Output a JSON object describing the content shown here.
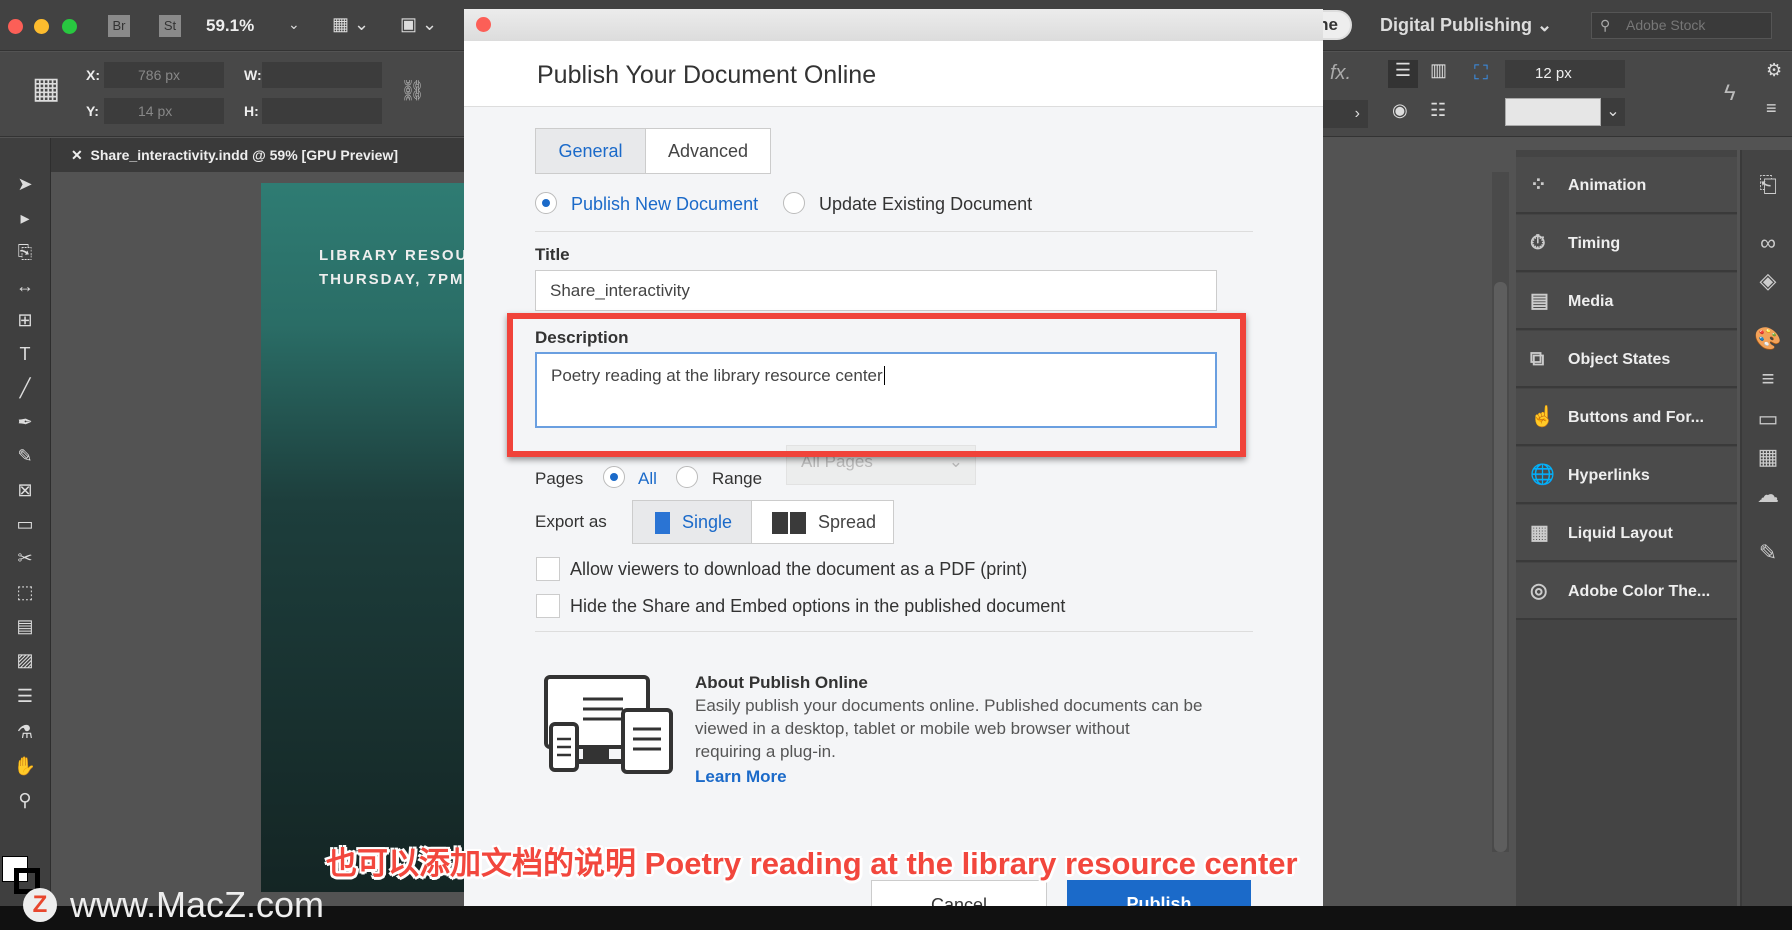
{
  "app": {
    "bridge": "Br",
    "stock": "St",
    "zoom": "59.1%",
    "workspace": "Digital Publishing",
    "search_placeholder": "Adobe Stock",
    "tab_title": "Share_interactivity.indd @ 59% [GPU Preview]",
    "partial_button": "ne"
  },
  "controls": {
    "x_label": "X:",
    "x_value": "786 px",
    "y_label": "Y:",
    "y_value": "14 px",
    "w_label": "W:",
    "h_label": "H:",
    "stroke_value": "12 px",
    "fx": "fx."
  },
  "canvas": {
    "line1": "LIBRARY RESOU",
    "line2": "THURSDAY, 7PM"
  },
  "dialog": {
    "title": "Publish Your Document Online",
    "tabs": [
      {
        "label": "General",
        "active": true
      },
      {
        "label": "Advanced",
        "active": false
      }
    ],
    "mode_options": [
      {
        "label": "Publish New Document",
        "selected": true
      },
      {
        "label": "Update Existing Document",
        "selected": false
      }
    ],
    "title_label": "Title",
    "title_value": "Share_interactivity",
    "description_label": "Description",
    "description_value": "Poetry reading at the library resource center",
    "pages_label": "Pages",
    "pages_all": "All",
    "pages_range": "Range",
    "pages_select": "All Pages",
    "export_label": "Export as",
    "export_single": "Single",
    "export_spread": "Spread",
    "checkbox_pdf": "Allow viewers to download the document as a PDF (print)",
    "checkbox_hide": "Hide the Share and Embed options in the published document",
    "about_title": "About Publish Online",
    "about_lines": [
      "Easily publish your documents online. Published documents can be",
      "viewed in a desktop, tablet or mobile web browser without",
      "requiring a plug-in."
    ],
    "learn_more": "Learn More",
    "cancel": "Cancel",
    "publish": "Publish"
  },
  "panels": [
    "Animation",
    "Timing",
    "Media",
    "Object States",
    "Buttons and For...",
    "Hyperlinks",
    "Liquid Layout",
    "Adobe Color The..."
  ],
  "caption": "也可以添加文档的说明 Poetry reading at the library resource center",
  "watermark": "www.MacZ.com",
  "colors": {
    "accent": "#1b6ac9",
    "highlight": "#f0433a"
  }
}
